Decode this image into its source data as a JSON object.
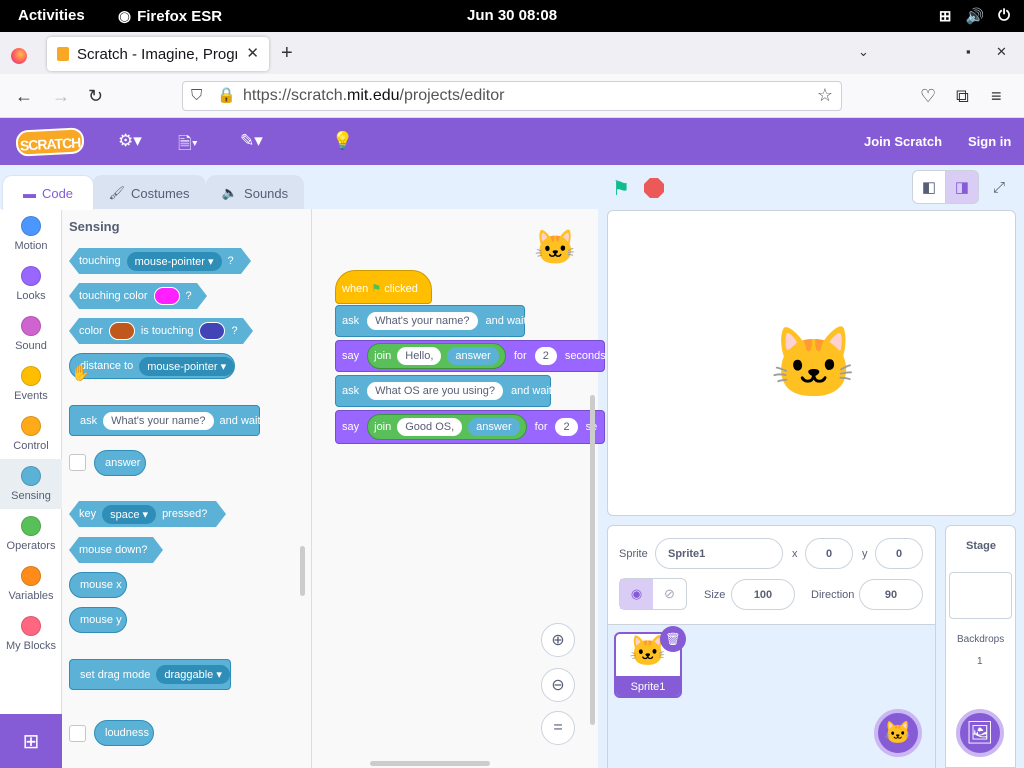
{
  "system": {
    "activities": "Activities",
    "app": "Firefox ESR",
    "clock": "Jun 30  08:08"
  },
  "browser": {
    "tab_title": "Scratch - Imagine, Program, Share",
    "url_prefix": "https://scratch.",
    "url_domain": "mit.edu",
    "url_path": "/projects/editor"
  },
  "menubar": {
    "logo": "SCRATCH",
    "join": "Join Scratch",
    "signin": "Sign in"
  },
  "editor_tabs": {
    "code": "Code",
    "costumes": "Costumes",
    "sounds": "Sounds"
  },
  "categories": [
    {
      "label": "Motion",
      "color": "#4c97ff"
    },
    {
      "label": "Looks",
      "color": "#9966ff"
    },
    {
      "label": "Sound",
      "color": "#cf63cf"
    },
    {
      "label": "Events",
      "color": "#ffbf00"
    },
    {
      "label": "Control",
      "color": "#ffab19"
    },
    {
      "label": "Sensing",
      "color": "#5cb1d6"
    },
    {
      "label": "Operators",
      "color": "#59c059"
    },
    {
      "label": "Variables",
      "color": "#ff8c1a"
    },
    {
      "label": "My Blocks",
      "color": "#ff6680"
    }
  ],
  "palette": {
    "title": "Sensing",
    "touching": "touching",
    "touching_dd": "mouse-pointer",
    "q": "?",
    "touching_color": "touching color",
    "touching_color_swatch": "#ff1fff",
    "color": "color",
    "color_a": "#c0571b",
    "is_touching": "is touching",
    "color_b": "#4343b8",
    "distance_to": "distance to",
    "distance_dd": "mouse-pointer",
    "ask": "ask",
    "ask_default": "What's your name?",
    "and_wait": "and wait",
    "answer": "answer",
    "key": "key",
    "key_dd": "space",
    "pressed": "pressed?",
    "mouse_down": "mouse down?",
    "mouse_x": "mouse x",
    "mouse_y": "mouse y",
    "set_drag": "set drag mode",
    "drag_dd": "draggable",
    "loudness": "loudness"
  },
  "script": {
    "hat_when": "when",
    "hat_clicked": "clicked",
    "ask1_label": "ask",
    "ask1_text": "What's your name?",
    "ask1_wait": "and wait",
    "say1_label": "say",
    "join_label": "join",
    "join1_text": "Hello,",
    "answer": "answer",
    "for": "for",
    "say1_secs": "2",
    "say1_unit": "seconds",
    "ask2_text": "What OS are you using?",
    "join2_text": "Good OS,",
    "say2_secs": "2",
    "say2_unit": "se"
  },
  "sprite_info": {
    "sprite_label": "Sprite",
    "sprite_name": "Sprite1",
    "x_label": "x",
    "x": "0",
    "y_label": "y",
    "y": "0",
    "size_label": "Size",
    "size": "100",
    "direction_label": "Direction",
    "direction": "90"
  },
  "sprites": [
    {
      "name": "Sprite1"
    }
  ],
  "stage_panel": {
    "title": "Stage",
    "backdrops_label": "Backdrops",
    "backdrops_count": "1"
  }
}
